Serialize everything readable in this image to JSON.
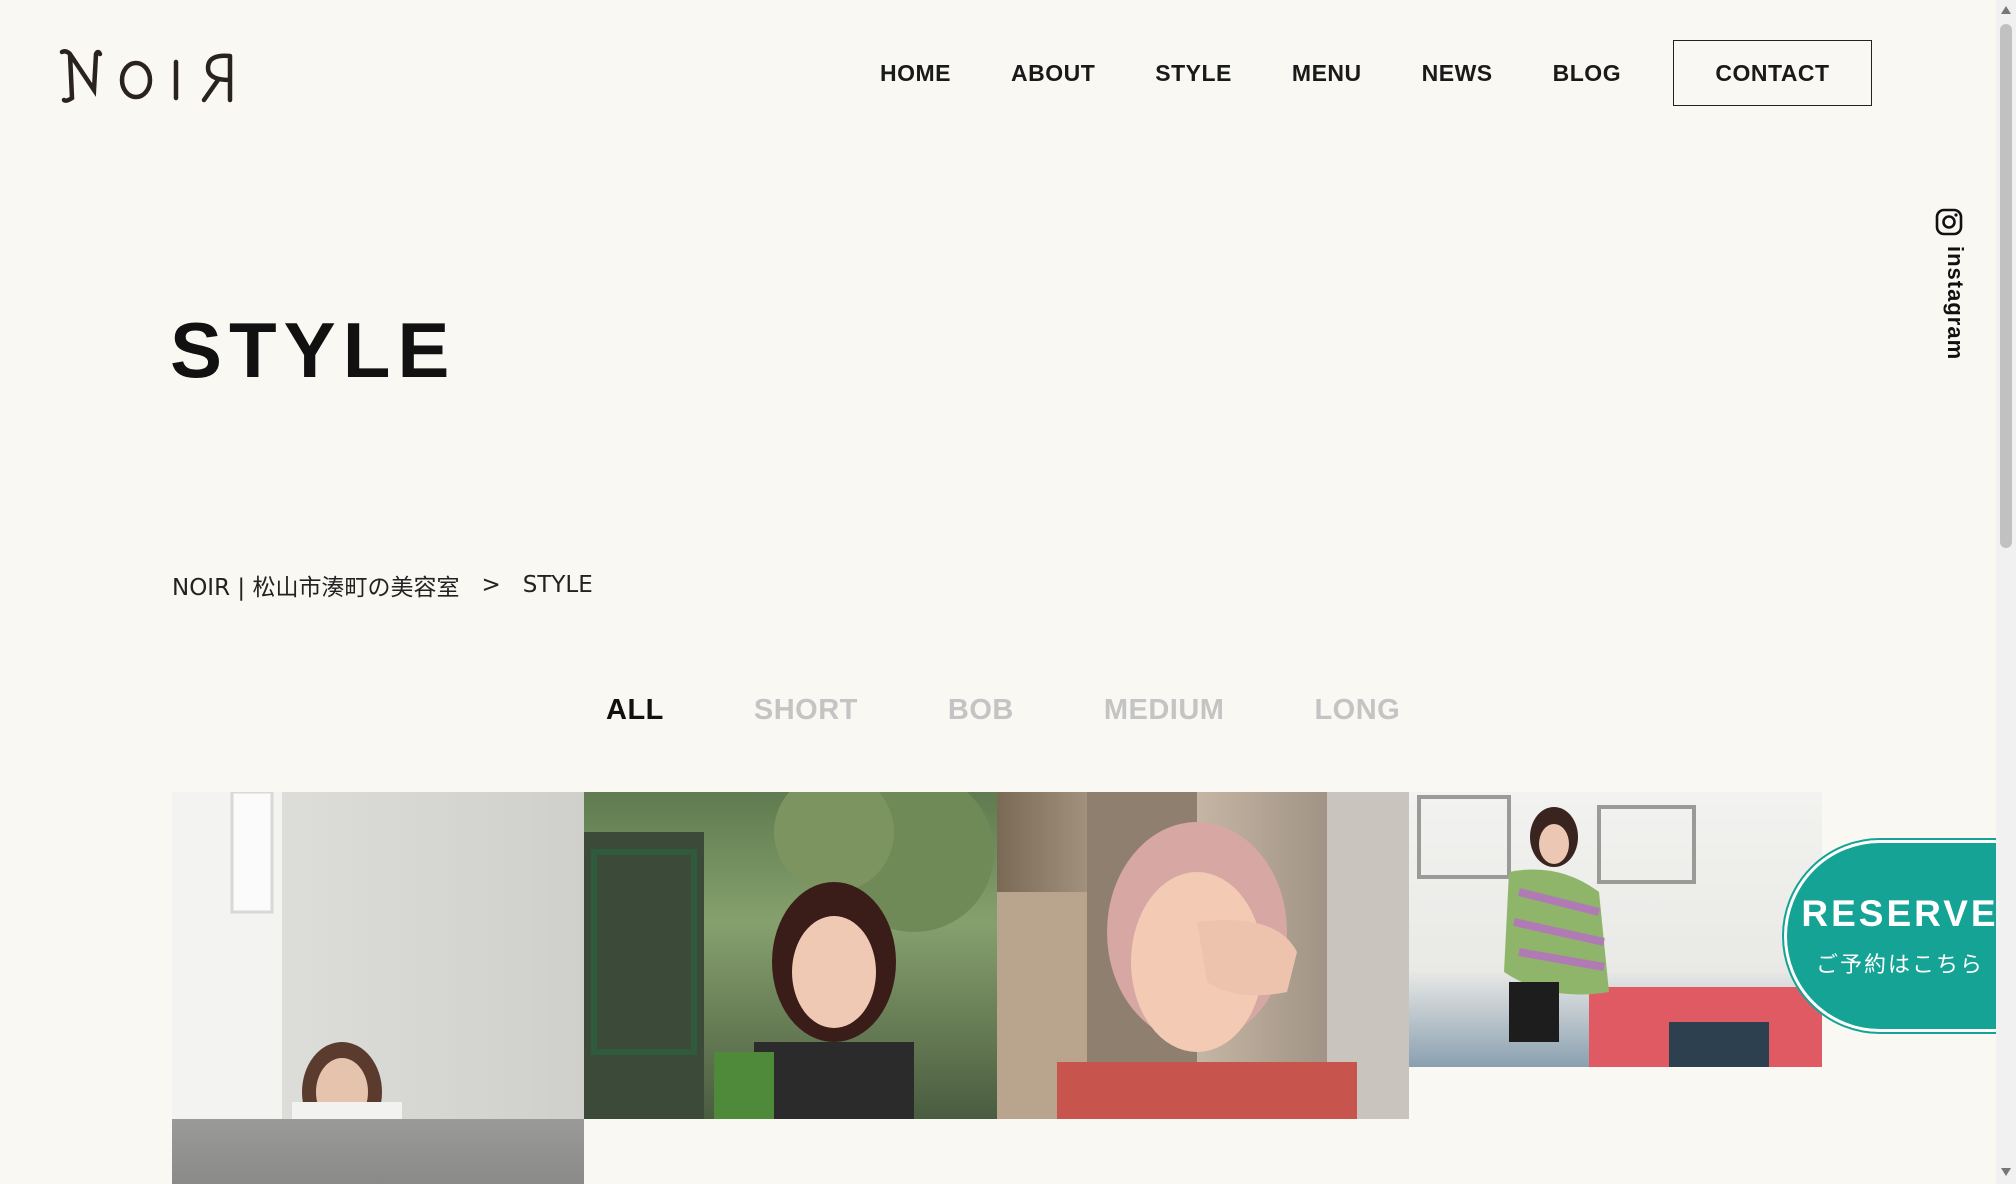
{
  "header": {
    "logo_text": "NOIR",
    "nav": [
      {
        "label": "HOME"
      },
      {
        "label": "ABOUT"
      },
      {
        "label": "STYLE"
      },
      {
        "label": "MENU"
      },
      {
        "label": "NEWS"
      },
      {
        "label": "BLOG"
      }
    ],
    "contact_label": "CONTACT"
  },
  "social": {
    "instagram_label": "instagram",
    "icon": "instagram-icon"
  },
  "page": {
    "title": "STYLE"
  },
  "breadcrumb": {
    "home": "NOIR | 松山市湊町の美容室",
    "separator": ">",
    "current": "STYLE"
  },
  "filters": [
    {
      "label": "ALL",
      "active": true
    },
    {
      "label": "SHORT",
      "active": false
    },
    {
      "label": "BOB",
      "active": false
    },
    {
      "label": "MEDIUM",
      "active": false
    },
    {
      "label": "LONG",
      "active": false
    }
  ],
  "reserve": {
    "main": "RESERVE",
    "sub": "ご予約はこちら",
    "color": "#14a395"
  },
  "colors": {
    "background": "#f9f8f3",
    "text": "#111111",
    "inactive_filter": "#c4c4c4"
  }
}
